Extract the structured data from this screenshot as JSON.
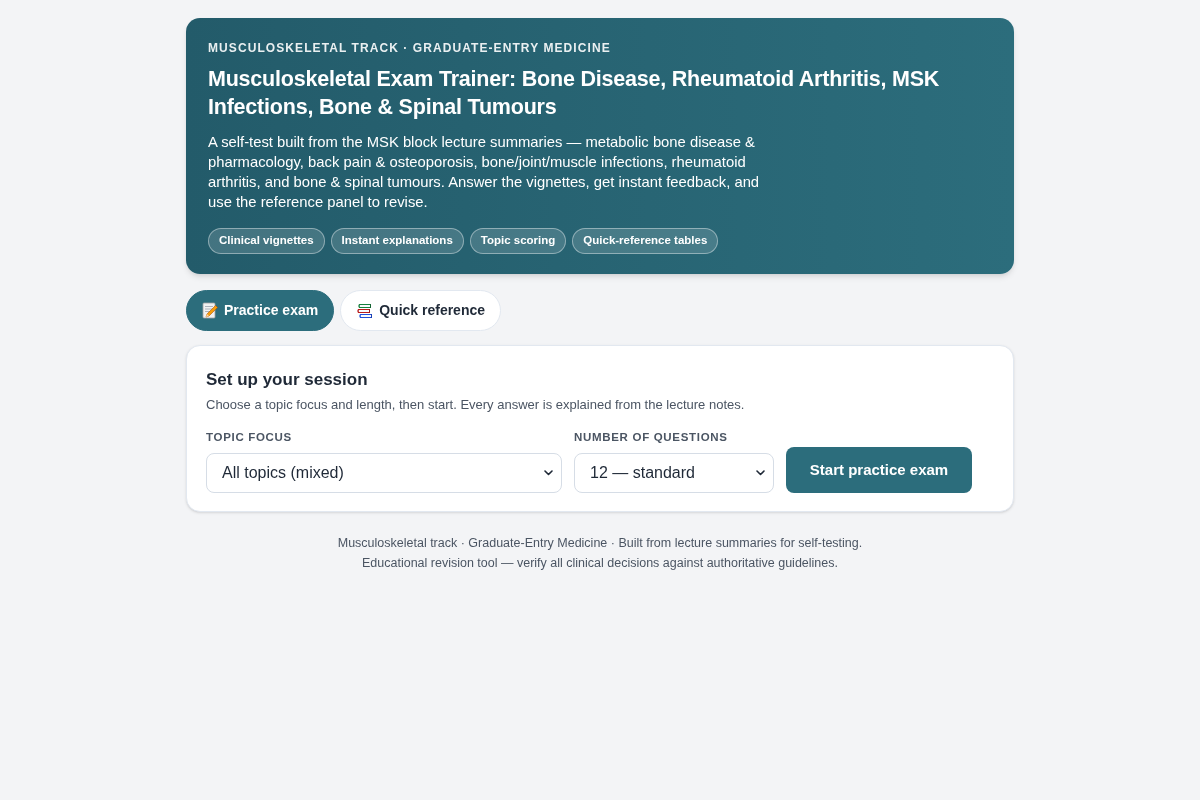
{
  "header": {
    "eyebrow": "MUSCULOSKELETAL TRACK · GRADUATE-ENTRY MEDICINE",
    "title": "Musculoskeletal Exam Trainer: Bone Disease, Rheumatoid Arthritis, MSK Infections, Bone & Spinal Tumours",
    "description": "A self-test built from the MSK block lecture summaries — metabolic bone disease & pharmacology, back pain & osteoporosis, bone/joint/muscle infections, rheumatoid arthritis, and bone & spinal tumours. Answer the vignettes, get instant feedback, and use the reference panel to revise.",
    "features": [
      "Clinical vignettes",
      "Instant explanations",
      "Topic scoring",
      "Quick-reference tables"
    ]
  },
  "tabs": [
    {
      "kind": "memo",
      "label": "Practice exam",
      "selected": true
    },
    {
      "kind": "books",
      "label": "Quick reference",
      "selected": false
    }
  ],
  "session": {
    "title": "Set up your session",
    "subtitle": "Choose a topic focus and length, then start. Every answer is explained from the lecture notes.",
    "fields": [
      {
        "label": "TOPIC FOCUS",
        "value": "All topics (mixed)"
      },
      {
        "label": "NUMBER OF QUESTIONS",
        "value": "12 — standard"
      }
    ],
    "button": "Start practice exam"
  },
  "footer": [
    "Musculoskeletal track · Graduate-Entry Medicine · Built from lecture summaries for self-testing.",
    "Educational revision tool — verify all clinical decisions against authoritative guidelines."
  ]
}
